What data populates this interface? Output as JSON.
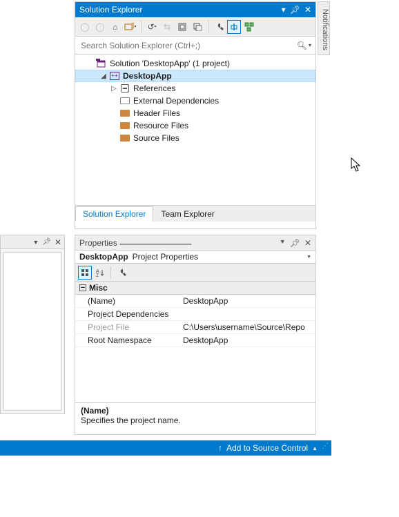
{
  "notifications_tab": "Notifications",
  "solution_explorer": {
    "title": "Solution Explorer",
    "search_placeholder": "Search Solution Explorer (Ctrl+;)",
    "root": "Solution 'DesktopApp' (1 project)",
    "project": "DesktopApp",
    "nodes": {
      "references": "References",
      "external_deps": "External Dependencies",
      "header_files": "Header Files",
      "resource_files": "Resource Files",
      "source_files": "Source Files"
    },
    "tabs": {
      "sol": "Solution Explorer",
      "team": "Team Explorer"
    }
  },
  "properties": {
    "title": "Properties",
    "object": "DesktopApp",
    "object_type": "Project Properties",
    "category": "Misc",
    "rows": {
      "name_k": "(Name)",
      "name_v": "DesktopApp",
      "deps_k": "Project Dependencies",
      "deps_v": "",
      "file_k": "Project File",
      "file_v": "C:\\Users\\username\\Source\\Repo",
      "ns_k": "Root Namespace",
      "ns_v": "DesktopApp"
    },
    "desc_name": "(Name)",
    "desc_text": "Specifies the project name."
  },
  "status": {
    "add_src": "Add to Source Control"
  }
}
